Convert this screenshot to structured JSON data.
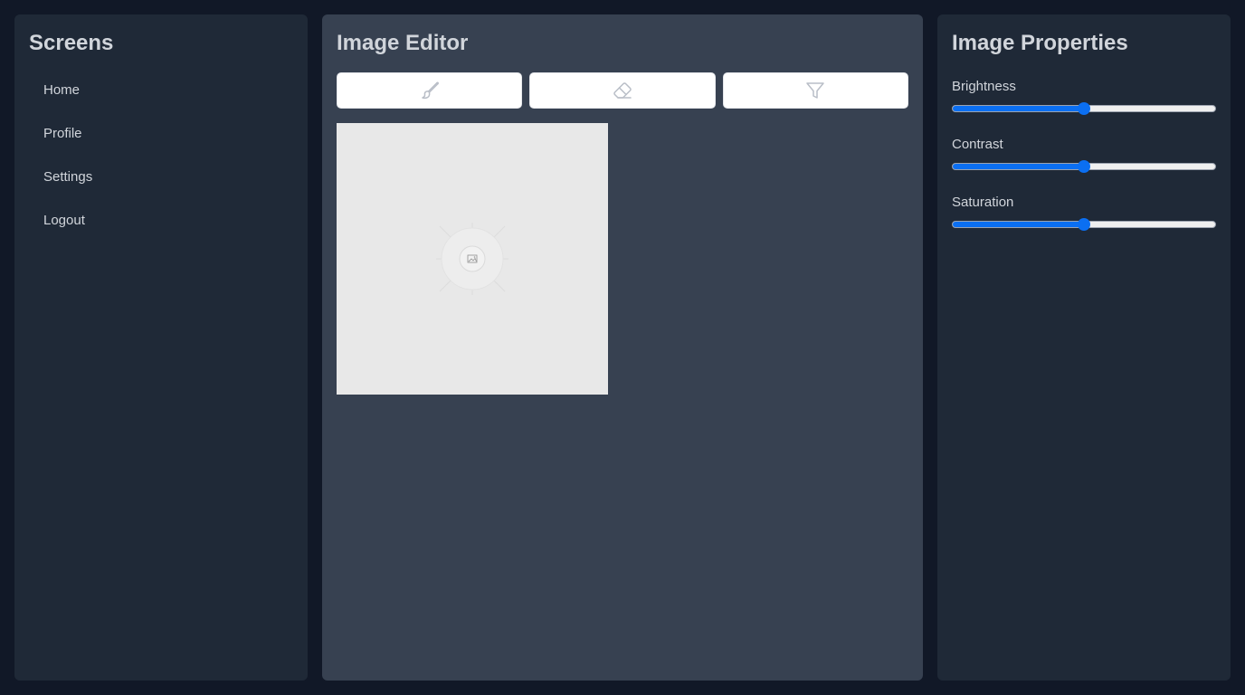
{
  "sidebar": {
    "title": "Screens",
    "items": [
      {
        "label": "Home"
      },
      {
        "label": "Profile"
      },
      {
        "label": "Settings"
      },
      {
        "label": "Logout"
      }
    ]
  },
  "editor": {
    "title": "Image Editor",
    "tools": [
      {
        "icon": "paintbrush-icon"
      },
      {
        "icon": "eraser-icon"
      },
      {
        "icon": "filter-icon"
      }
    ],
    "canvas_icon": "image-placeholder-icon"
  },
  "properties": {
    "title": "Image Properties",
    "sliders": [
      {
        "label": "Brightness",
        "value": 0.5
      },
      {
        "label": "Contrast",
        "value": 0.5
      },
      {
        "label": "Saturation",
        "value": 0.5
      }
    ]
  },
  "colors": {
    "background": "#111827",
    "side_panel": "#1f2937",
    "center_panel": "#374151",
    "text": "#d1d5db",
    "accent": "#0b6ff2",
    "canvas": "#e8e8e8"
  }
}
